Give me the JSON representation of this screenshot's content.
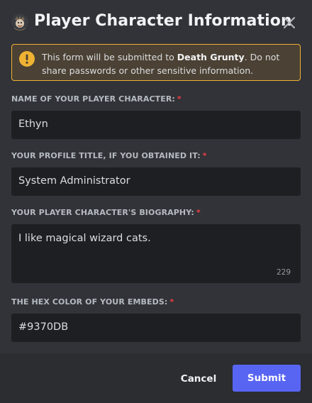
{
  "modal": {
    "title": "Player Character Information",
    "app_icon": "character-avatar-icon",
    "close_icon": "close-icon"
  },
  "notice": {
    "icon": "warning-icon",
    "prefix": "This form will be submitted to ",
    "recipient": "Death Grunty",
    "suffix": ". Do not share passwords or other sensitive information.",
    "accent_color": "#f0b232"
  },
  "fields": [
    {
      "label": "NAME OF YOUR PLAYER CHARACTER:",
      "required_mark": "*",
      "value": "Ethyn"
    },
    {
      "label": "YOUR PROFILE TITLE, IF YOU OBTAINED IT:",
      "required_mark": "*",
      "value": "System Administrator"
    },
    {
      "label": "YOUR PLAYER CHARACTER'S BIOGRAPHY:",
      "required_mark": "*",
      "value": "I like magical wizard cats.",
      "char_count": "229"
    },
    {
      "label": "THE HEX COLOR OF YOUR EMBEDS:",
      "required_mark": "*",
      "value": "#9370DB"
    }
  ],
  "footer": {
    "cancel_label": "Cancel",
    "submit_label": "Submit",
    "submit_color": "#5865f2"
  }
}
